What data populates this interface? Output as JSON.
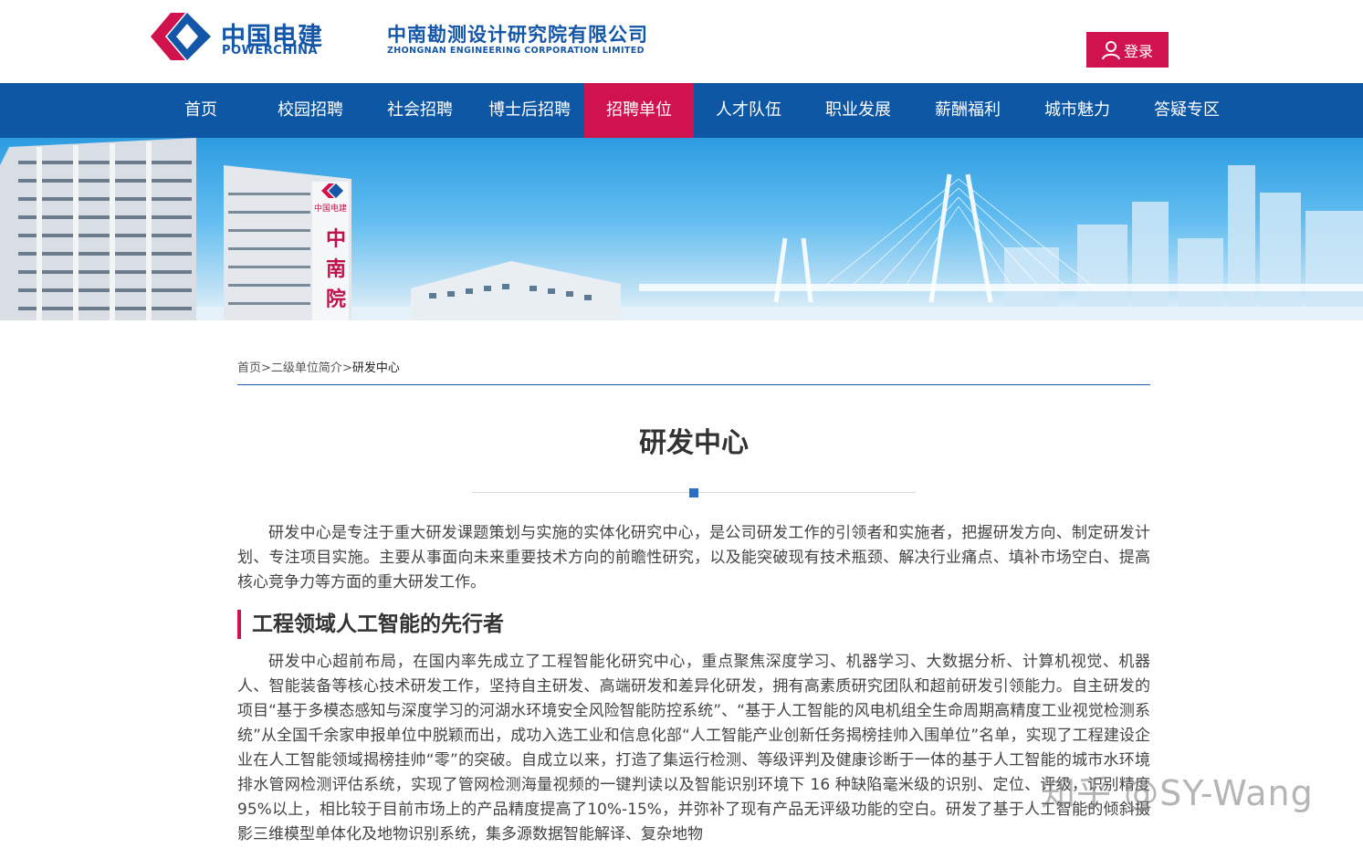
{
  "header": {
    "brand_cn": "中国电建",
    "brand_en": "POWERCHINA",
    "company_cn": "中南勘测设计研究院有限公司",
    "company_en": "ZHONGNAN ENGINEERING CORPORATION LIMITED",
    "login_label": "登录",
    "login_icon": "user-icon",
    "brand_color": "#1457a8",
    "accent_color": "#d0124f"
  },
  "nav": {
    "items": [
      {
        "label": "首页"
      },
      {
        "label": "校园招聘"
      },
      {
        "label": "社会招聘"
      },
      {
        "label": "博士后招聘"
      },
      {
        "label": "招聘单位"
      },
      {
        "label": "人才队伍"
      },
      {
        "label": "职业发展"
      },
      {
        "label": "薪酬福利"
      },
      {
        "label": "城市魅力"
      },
      {
        "label": "答疑专区"
      }
    ],
    "active": "招聘单位",
    "bg_color": "#0d57a5"
  },
  "banner": {
    "building_sign": "中南院",
    "building_logo": "中国电建"
  },
  "breadcrumb": {
    "home": "首页",
    "sep1": ">",
    "parent": "二级单位简介",
    "sep2": ">",
    "current": "研发中心"
  },
  "page": {
    "title": "研发中心",
    "intro": "研发中心是专注于重大研发课题策划与实施的实体化研究中心，是公司研发工作的引领者和实施者，把握研发方向、制定研发计划、专注项目实施。主要从事面向未来重要技术方向的前瞻性研究，以及能突破现有技术瓶颈、解决行业痛点、填补市场空白、提高核心竞争力等方面的重大研发工作。",
    "section1_heading": "工程领域人工智能的先行者",
    "section1_body": "研发中心超前布局，在国内率先成立了工程智能化研究中心，重点聚焦深度学习、机器学习、大数据分析、计算机视觉、机器人、智能装备等核心技术研发工作，坚持自主研发、高端研发和差异化研发，拥有高素质研究团队和超前研发引领能力。自主研发的项目“基于多模态感知与深度学习的河湖水环境安全风险智能防控系统”、“基于人工智能的风电机组全生命周期高精度工业视觉检测系统”从全国千余家申报单位中脱颖而出，成功入选工业和信息化部“人工智能产业创新任务揭榜挂帅入围单位”名单，实现了工程建设企业在人工智能领域揭榜挂帅“零”的突破。自成立以来，打造了集运行检测、等级评判及健康诊断于一体的基于人工智能的城市水环境排水管网检测评估系统，实现了管网检测海量视频的一键判读以及智能识别环境下 16 种缺陷毫米级的识别、定位、评级，识别精度95%以上，相比较于目前市场上的产品精度提高了10%-15%，并弥补了现有产品无评级功能的空白。研发了基于人工智能的倾斜摄影三维模型单体化及地物识别系统，集多源数据智能解译、复杂地物"
  },
  "watermark": "知乎 @SY-Wang"
}
